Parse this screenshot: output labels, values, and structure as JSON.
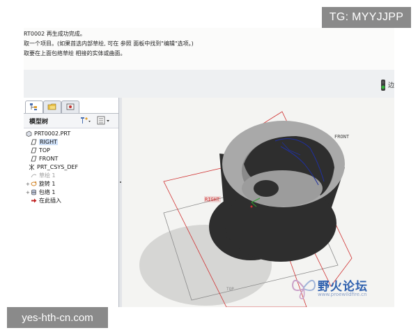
{
  "watermarks": {
    "tg_label": "TG: MYYJJPP",
    "site_label": "yes-hth-cn.com"
  },
  "message_area": {
    "lines": [
      "RT0002 再生成功完成。",
      "取一个项目。(如果首选内部草绘, 可在 参照 面板中找到\"编辑\"选项。)",
      "",
      "取要在上面包络草绘 相接的实体或曲面。"
    ]
  },
  "toolbar": {
    "more_label": "边"
  },
  "left_panel": {
    "title": "模型树",
    "tree": [
      {
        "label": "PRT0002.PRT",
        "icon": "part-icon",
        "level": 0,
        "selected": false,
        "dim": false
      },
      {
        "label": "RIGHT",
        "icon": "datum-plane-icon",
        "level": 1,
        "selected": true,
        "dim": false
      },
      {
        "label": "TOP",
        "icon": "datum-plane-icon",
        "level": 1,
        "selected": false,
        "dim": false
      },
      {
        "label": "FRONT",
        "icon": "datum-plane-icon",
        "level": 1,
        "selected": false,
        "dim": false
      },
      {
        "label": "PRT_CSYS_DEF",
        "icon": "csys-icon",
        "level": 1,
        "selected": false,
        "dim": false
      },
      {
        "label": "草绘 1",
        "icon": "sketch-icon",
        "level": 1,
        "selected": false,
        "dim": true
      },
      {
        "label": "旋转 1",
        "icon": "revolve-icon",
        "level": 1,
        "selected": false,
        "dim": false
      },
      {
        "label": "包络 1",
        "icon": "wrap-icon",
        "level": 1,
        "selected": false,
        "dim": false
      },
      {
        "label": "在此插入",
        "icon": "insert-here-icon",
        "level": 1,
        "selected": false,
        "dim": false
      }
    ]
  },
  "viewport": {
    "plane_labels": {
      "front": "FRONT",
      "right": "RIGHT",
      "top": "TOP"
    }
  },
  "logo": {
    "text": "野火论坛",
    "url": "www.proewildfire.cn"
  },
  "colors": {
    "part_body": "#2e2e2e",
    "part_rim": "#a9a9a9",
    "datum_red": "#d03030",
    "datum_gray": "#8a8a8a",
    "sketch_blue": "#2030a0",
    "logo_blue": "#2d5fae"
  }
}
